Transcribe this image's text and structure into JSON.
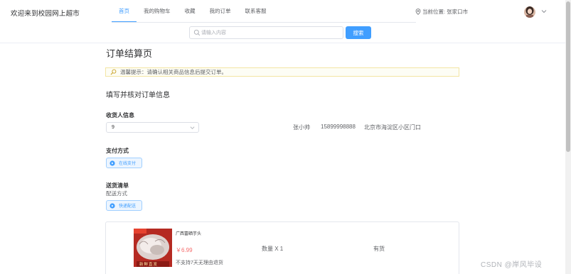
{
  "header": {
    "site_title": "欢迎来到校园网上超市",
    "nav": [
      {
        "label": "首页",
        "active": true
      },
      {
        "label": "我的购物车",
        "active": false
      },
      {
        "label": "收藏",
        "active": false
      },
      {
        "label": "我的订单",
        "active": false
      },
      {
        "label": "联系客服",
        "active": false
      }
    ],
    "location": "当前位置: 张家口市",
    "location_icon": "location-pin-icon",
    "avatar_icon": "user-avatar",
    "caret_icon": "chevron-down-icon"
  },
  "search": {
    "placeholder": "请输入内容",
    "button_label": "搜索",
    "icon": "search-icon"
  },
  "page": {
    "title": "订单结算页",
    "notice_label": "温馨提示：",
    "notice_text": "请确认相关商品信息后提交订单。",
    "section_title": "填写并核对订单信息"
  },
  "receiver": {
    "label": "收货人信息",
    "select_value": "9",
    "name": "张小帅",
    "phone": "15899998888",
    "address": "北京市海淀区小区门口"
  },
  "payment": {
    "label": "支付方式",
    "option": "在线支付"
  },
  "delivery": {
    "label": "送货清单",
    "sub_label": "配送方式",
    "option": "快递配送"
  },
  "goods": {
    "name": "广西富硒芋头",
    "price": "￥6.99",
    "policy": "不支持7天无理由退货",
    "quantity": "数量 X 1",
    "stock": "有货",
    "image_overlay_text": "新鲜直发"
  },
  "watermark": "CSDN @岸风毕设",
  "colors": {
    "primary": "#409eff",
    "price": "#f56c6c",
    "notice_border": "#f3e5a4"
  }
}
